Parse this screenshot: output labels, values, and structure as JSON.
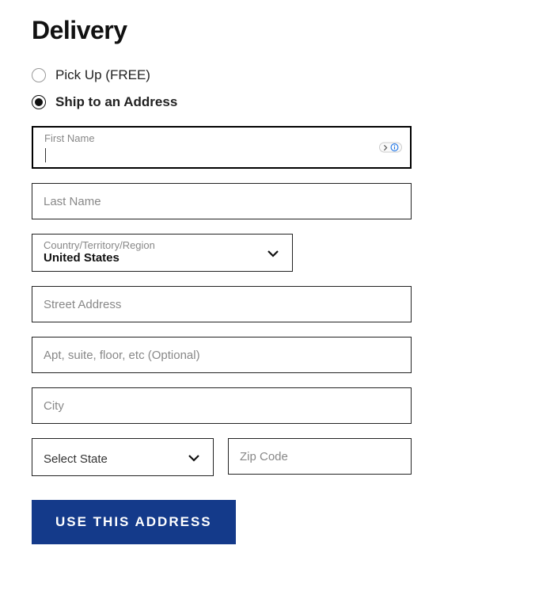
{
  "title": "Delivery",
  "options": {
    "pickup": {
      "label": "Pick Up (FREE)",
      "selected": false
    },
    "ship": {
      "label": "Ship to an Address",
      "selected": true
    }
  },
  "form": {
    "first_name": {
      "label": "First Name",
      "value": ""
    },
    "last_name": {
      "placeholder": "Last Name",
      "value": ""
    },
    "country": {
      "label": "Country/Territory/Region",
      "value": "United States"
    },
    "street": {
      "placeholder": "Street Address",
      "value": ""
    },
    "apt": {
      "placeholder": "Apt, suite, floor, etc (Optional)",
      "value": ""
    },
    "city": {
      "placeholder": "City",
      "value": ""
    },
    "state": {
      "placeholder": "Select State",
      "value": ""
    },
    "zip": {
      "placeholder": "Zip Code",
      "value": ""
    }
  },
  "submit_label": "USE THIS ADDRESS"
}
